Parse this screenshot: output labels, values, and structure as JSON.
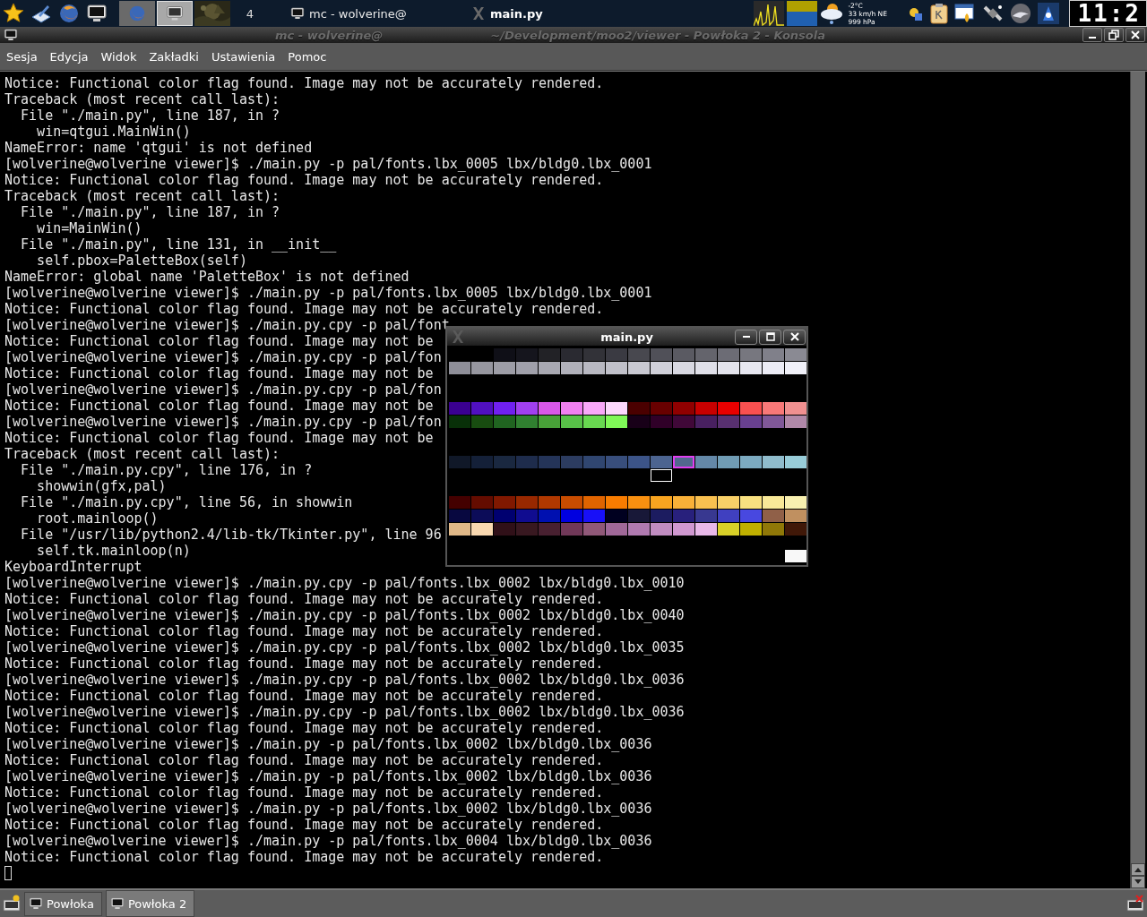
{
  "top_panel": {
    "pager": [
      {
        "kind": "window",
        "selected": false
      },
      {
        "kind": "terminal",
        "selected": true
      },
      {
        "kind": "wallpaper",
        "selected": false
      },
      {
        "kind": "label",
        "label": "4",
        "selected": false
      }
    ],
    "tasks": [
      {
        "label": "mc - wolverine@",
        "selected": false
      },
      {
        "label": "main.py",
        "selected": true
      }
    ],
    "weather": {
      "temperature": "-2°C",
      "wind": "33 km/h NE",
      "pressure": "999 hPa"
    },
    "clock": "11:2"
  },
  "window": {
    "title_parts": [
      "mc - wolverine@",
      "~/Development/moo2/viewer - Powłoka 2 - Konsola"
    ]
  },
  "menu": [
    "Sesja",
    "Edycja",
    "Widok",
    "Zakładki",
    "Ustawienia",
    "Pomoc"
  ],
  "terminal": {
    "lines": [
      "Notice: Functional color flag found. Image may not be accurately rendered.",
      "Traceback (most recent call last):",
      "  File \"./main.py\", line 187, in ?",
      "    win=qtgui.MainWin()",
      "NameError: name 'qtgui' is not defined",
      "[wolverine@wolverine viewer]$ ./main.py -p pal/fonts.lbx_0005 lbx/bldg0.lbx_0001",
      "Notice: Functional color flag found. Image may not be accurately rendered.",
      "Traceback (most recent call last):",
      "  File \"./main.py\", line 187, in ?",
      "    win=MainWin()",
      "  File \"./main.py\", line 131, in __init__",
      "    self.pbox=PaletteBox(self)",
      "NameError: global name 'PaletteBox' is not defined",
      "[wolverine@wolverine viewer]$ ./main.py -p pal/fonts.lbx_0005 lbx/bldg0.lbx_0001",
      "Notice: Functional color flag found. Image may not be accurately rendered.",
      "[wolverine@wolverine viewer]$ ./main.py.cpy -p pal/font",
      "Notice: Functional color flag found. Image may not be",
      "[wolverine@wolverine viewer]$ ./main.py.cpy -p pal/fon",
      "Notice: Functional color flag found. Image may not be",
      "[wolverine@wolverine viewer]$ ./main.py.cpy -p pal/fon",
      "Notice: Functional color flag found. Image may not be",
      "[wolverine@wolverine viewer]$ ./main.py.cpy -p pal/fon",
      "Notice: Functional color flag found. Image may not be",
      "Traceback (most recent call last):",
      "  File \"./main.py.cpy\", line 176, in ?",
      "    showwin(gfx,pal)",
      "  File \"./main.py.cpy\", line 56, in showwin",
      "    root.mainloop()",
      "  File \"/usr/lib/python2.4/lib-tk/Tkinter.py\", line 96",
      "    self.tk.mainloop(n)",
      "KeyboardInterrupt",
      "[wolverine@wolverine viewer]$ ./main.py.cpy -p pal/fonts.lbx_0002 lbx/bldg0.lbx_0010",
      "Notice: Functional color flag found. Image may not be accurately rendered.",
      "[wolverine@wolverine viewer]$ ./main.py.cpy -p pal/fonts.lbx_0002 lbx/bldg0.lbx_0040",
      "Notice: Functional color flag found. Image may not be accurately rendered.",
      "[wolverine@wolverine viewer]$ ./main.py.cpy -p pal/fonts.lbx_0002 lbx/bldg0.lbx_0035",
      "Notice: Functional color flag found. Image may not be accurately rendered.",
      "[wolverine@wolverine viewer]$ ./main.py.cpy -p pal/fonts.lbx_0002 lbx/bldg0.lbx_0036",
      "Notice: Functional color flag found. Image may not be accurately rendered.",
      "[wolverine@wolverine viewer]$ ./main.py.cpy -p pal/fonts.lbx_0002 lbx/bldg0.lbx_0036",
      "Notice: Functional color flag found. Image may not be accurately rendered.",
      "[wolverine@wolverine viewer]$ ./main.py -p pal/fonts.lbx_0002 lbx/bldg0.lbx_0036",
      "Notice: Functional color flag found. Image may not be accurately rendered.",
      "[wolverine@wolverine viewer]$ ./main.py -p pal/fonts.lbx_0002 lbx/bldg0.lbx_0036",
      "Notice: Functional color flag found. Image may not be accurately rendered.",
      "[wolverine@wolverine viewer]$ ./main.py -p pal/fonts.lbx_0002 lbx/bldg0.lbx_0036",
      "Notice: Functional color flag found. Image may not be accurately rendered.",
      "[wolverine@wolverine viewer]$ ./main.py -p pal/fonts.lbx_0004 lbx/bldg0.lbx_0036",
      "Notice: Functional color flag found. Image may not be accurately rendered."
    ]
  },
  "palette_window": {
    "title": "main.py",
    "rows": [
      [
        null,
        null,
        {
          "color": "#0f0f17"
        },
        {
          "color": "#15151d"
        },
        {
          "color": "#222226"
        },
        {
          "color": "#2a2a31"
        },
        {
          "color": "#323238"
        },
        {
          "color": "#3a3a42"
        },
        {
          "color": "#48484f"
        },
        {
          "color": "#505058"
        },
        {
          "color": "#5a5a62"
        },
        {
          "color": "#64646c"
        },
        {
          "color": "#6c6c75"
        },
        {
          "color": "#77777f"
        },
        {
          "color": "#80808a"
        },
        {
          "color": "#8a8a93"
        }
      ],
      [
        {
          "color": "#8e8e98"
        },
        {
          "color": "#96969f"
        },
        {
          "color": "#9d9da6"
        },
        {
          "color": "#a0a0aa"
        },
        {
          "color": "#a8a8b1"
        },
        {
          "color": "#b0b0b9"
        },
        {
          "color": "#b8b8c1"
        },
        {
          "color": "#c0c0c9"
        },
        {
          "color": "#c8c8d1"
        },
        {
          "color": "#d0d0d9"
        },
        {
          "color": "#d8d8e1"
        },
        {
          "color": "#dfdfe8"
        },
        {
          "color": "#e3e3ec"
        },
        {
          "color": "#e7e7f0"
        },
        {
          "color": "#ececf5"
        },
        {
          "color": "#f0f0f8"
        }
      ],
      [
        null,
        null,
        null,
        null,
        null,
        null,
        null,
        null,
        null,
        null,
        null,
        null,
        null,
        null,
        null,
        null
      ],
      [
        null,
        null,
        null,
        null,
        null,
        null,
        null,
        null,
        null,
        null,
        null,
        null,
        null,
        null,
        null,
        null
      ],
      [
        {
          "color": "#3a0090"
        },
        {
          "color": "#5010c0"
        },
        {
          "color": "#7020f0"
        },
        {
          "color": "#a040f0"
        },
        {
          "color": "#d858e8"
        },
        {
          "color": "#f080f0"
        },
        {
          "color": "#f8a8f8"
        },
        {
          "color": "#fcd8fc"
        },
        {
          "color": "#4a0000"
        },
        {
          "color": "#680000"
        },
        {
          "color": "#900000"
        },
        {
          "color": "#c80000"
        },
        {
          "color": "#e80000"
        },
        {
          "color": "#f85050"
        },
        {
          "color": "#f87878"
        },
        {
          "color": "#f09090"
        }
      ],
      [
        {
          "color": "#083008"
        },
        {
          "color": "#184c10"
        },
        {
          "color": "#206420"
        },
        {
          "color": "#308030"
        },
        {
          "color": "#48a038"
        },
        {
          "color": "#58c048"
        },
        {
          "color": "#68d850"
        },
        {
          "color": "#80f858"
        },
        {
          "color": "#180018"
        },
        {
          "color": "#300028"
        },
        {
          "color": "#400838"
        },
        {
          "color": "#482060"
        },
        {
          "color": "#583070"
        },
        {
          "color": "#684090"
        },
        {
          "color": "#805898"
        },
        {
          "color": "#b088a8"
        }
      ],
      [
        null,
        null,
        null,
        null,
        null,
        null,
        null,
        null,
        null,
        null,
        null,
        null,
        null,
        null,
        null,
        null
      ],
      [
        null,
        null,
        null,
        null,
        null,
        null,
        null,
        null,
        null,
        null,
        null,
        null,
        null,
        null,
        null,
        null
      ],
      [
        {
          "color": "#101828"
        },
        {
          "color": "#142038"
        },
        {
          "color": "#1a2840"
        },
        {
          "color": "#1e2c4c"
        },
        {
          "color": "#243458"
        },
        {
          "color": "#2c3c60"
        },
        {
          "color": "#304670"
        },
        {
          "color": "#384e7c"
        },
        {
          "color": "#3c5488"
        },
        {
          "color": "#4c6490"
        },
        {
          "color": "#52688e",
          "selected": true
        },
        {
          "color": "#6488a8"
        },
        {
          "color": "#709cb4"
        },
        {
          "color": "#7caac0"
        },
        {
          "color": "#90bccc"
        },
        {
          "color": "#98ccd8"
        }
      ],
      [
        null,
        null,
        null,
        null,
        null,
        null,
        null,
        null,
        null,
        {
          "color": "#000000",
          "focused": true
        },
        null,
        null,
        null,
        null,
        null,
        null
      ],
      [
        null,
        null,
        null,
        null,
        null,
        null,
        null,
        null,
        null,
        null,
        null,
        null,
        null,
        null,
        null,
        null
      ],
      [
        {
          "color": "#440000"
        },
        {
          "color": "#640c00"
        },
        {
          "color": "#801800"
        },
        {
          "color": "#982800"
        },
        {
          "color": "#b03800"
        },
        {
          "color": "#c84c00"
        },
        {
          "color": "#e06400"
        },
        {
          "color": "#f87c00"
        },
        {
          "color": "#f89010"
        },
        {
          "color": "#f8a420"
        },
        {
          "color": "#f8b038"
        },
        {
          "color": "#f8c050"
        },
        {
          "color": "#f8d068"
        },
        {
          "color": "#f8e080"
        },
        {
          "color": "#f8e898"
        },
        {
          "color": "#f8f0b0"
        }
      ],
      [
        {
          "color": "#080840"
        },
        {
          "color": "#0c0c58"
        },
        {
          "color": "#000070"
        },
        {
          "color": "#100c90"
        },
        {
          "color": "#0010b0"
        },
        {
          "color": "#0000e0"
        },
        {
          "color": "#1810f8"
        },
        {
          "color": "#000020"
        },
        {
          "color": "#181838"
        },
        {
          "color": "#1c1c60"
        },
        {
          "color": "#28207c"
        },
        {
          "color": "#383890"
        },
        {
          "color": "#4040c0"
        },
        {
          "color": "#4848e0"
        },
        {
          "color": "#906048"
        },
        {
          "color": "#c09060"
        }
      ],
      [
        {
          "color": "#e0b888"
        },
        {
          "color": "#f8d8b0"
        },
        {
          "color": "#301018"
        },
        {
          "color": "#381820"
        },
        {
          "color": "#482030"
        },
        {
          "color": "#703858"
        },
        {
          "color": "#905878"
        },
        {
          "color": "#a06898"
        },
        {
          "color": "#b07ab0"
        },
        {
          "color": "#c08cc0"
        },
        {
          "color": "#d098d0"
        },
        {
          "color": "#e8b8e8"
        },
        {
          "color": "#d8d028"
        },
        {
          "color": "#c0b000"
        },
        {
          "color": "#907808"
        },
        {
          "color": "#401808"
        }
      ],
      [
        null,
        null,
        null,
        null,
        null,
        null,
        null,
        null,
        null,
        null,
        null,
        null,
        null,
        null,
        null,
        null
      ],
      [
        null,
        null,
        null,
        null,
        null,
        null,
        null,
        null,
        null,
        null,
        null,
        null,
        null,
        null,
        null,
        {
          "color": "#f8f8f8"
        }
      ]
    ]
  },
  "session_tabs": [
    {
      "label": "Powłoka",
      "selected": false
    },
    {
      "label": "Powłoka 2",
      "selected": true
    }
  ]
}
